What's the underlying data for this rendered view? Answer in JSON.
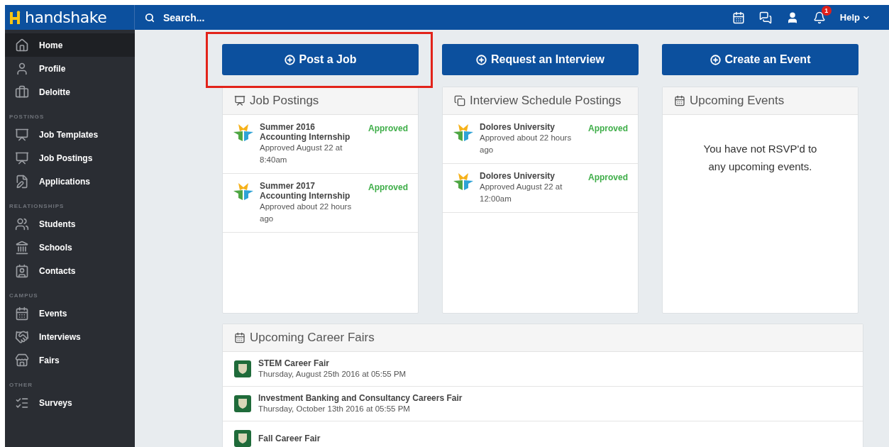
{
  "topbar": {
    "logo": "handshake",
    "search": {
      "placeholder": "Search..."
    },
    "notification_badge": "1",
    "help": "Help"
  },
  "sidebar": {
    "sections": [
      {
        "items": [
          {
            "label": "Home",
            "selected": true
          },
          {
            "label": "Profile",
            "selected": false
          },
          {
            "label": "Deloitte",
            "selected": false
          }
        ]
      },
      {
        "label": "POSTINGS",
        "items": [
          {
            "label": "Job Templates",
            "selected": false
          },
          {
            "label": "Job Postings",
            "selected": false
          },
          {
            "label": "Applications",
            "selected": false
          }
        ]
      },
      {
        "label": "RELATIONSHIPS",
        "items": [
          {
            "label": "Students",
            "selected": false
          },
          {
            "label": "Schools",
            "selected": false
          },
          {
            "label": "Contacts",
            "selected": false
          }
        ]
      },
      {
        "label": "CAMPUS",
        "items": [
          {
            "label": "Events",
            "selected": false
          },
          {
            "label": "Interviews",
            "selected": false
          },
          {
            "label": "Fairs",
            "selected": false
          }
        ]
      },
      {
        "label": "OTHER",
        "items": [
          {
            "label": "Surveys",
            "selected": false
          }
        ]
      }
    ]
  },
  "actions": [
    {
      "label": "Post a Job",
      "highlighted": true
    },
    {
      "label": "Request an Interview",
      "highlighted": false
    },
    {
      "label": "Create an Event",
      "highlighted": false
    }
  ],
  "cards": [
    {
      "title": "Job Postings",
      "items": [
        {
          "title": "Summer 2016 Accounting Internship",
          "detail": "Approved August 22 at 8:40am",
          "status": "Approved"
        },
        {
          "title": "Summer 2017 Accounting Internship",
          "detail": "Approved about 22 hours ago",
          "status": "Approved"
        }
      ]
    },
    {
      "title": "Interview Schedule Postings",
      "items": [
        {
          "title": "Dolores University",
          "detail": "Approved about 22 hours ago",
          "status": "Approved"
        },
        {
          "title": "Dolores University",
          "detail": "Approved August 22 at 12:00am",
          "status": "Approved"
        }
      ]
    },
    {
      "title": "Upcoming Events",
      "empty": "You have not RSVP'd to any upcoming events."
    }
  ],
  "career_fairs": {
    "title": "Upcoming Career Fairs",
    "items": [
      {
        "name": "STEM Career Fair",
        "date": "Thursday, August 25th 2016 at 05:55 PM"
      },
      {
        "name": "Investment Banking and Consultancy Careers Fair",
        "date": "Thursday, October 13th 2016 at 05:55 PM"
      },
      {
        "name": "Fall Career Fair"
      }
    ]
  }
}
